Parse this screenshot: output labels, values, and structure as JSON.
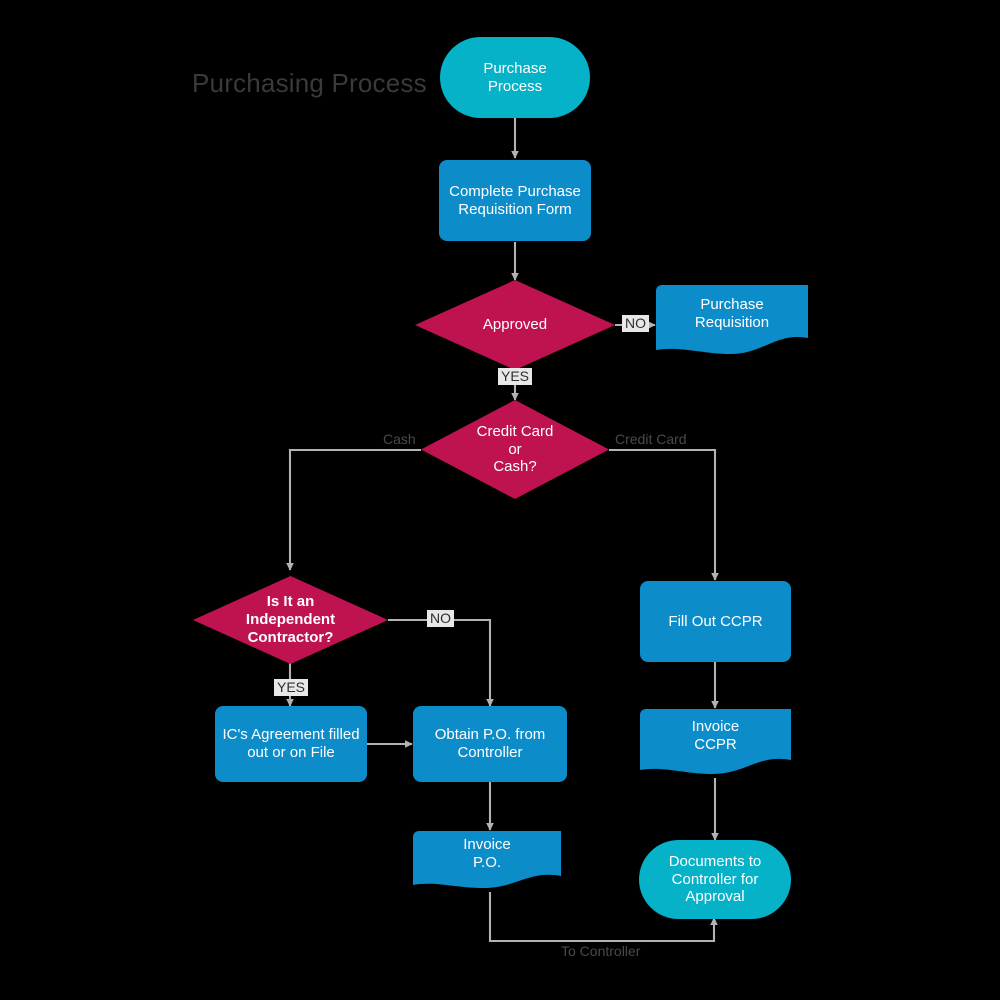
{
  "diagram": {
    "title": "Purchasing Process",
    "background_color": "#000000",
    "title_color": "#3a3a3a",
    "colors": {
      "terminator": "#06b2c8",
      "process": "#0d8cca",
      "decision": "#be1350",
      "document": "#0d8cca",
      "connector": "#b3b3b3",
      "label_text": "#2f2f2f",
      "label_background": "#e8e8e8",
      "node_text": "#ffffff"
    },
    "nodes": [
      {
        "id": "start",
        "type": "terminator",
        "label": "Purchase\nProcess"
      },
      {
        "id": "complete_pr",
        "type": "process",
        "label": "Complete Purchase\nRequisition Form"
      },
      {
        "id": "approved",
        "type": "decision",
        "label": "Approved"
      },
      {
        "id": "pr_doc",
        "type": "document",
        "label": "Purchase\nRequisition"
      },
      {
        "id": "cc_or_cash",
        "type": "decision",
        "label": "Credit Card\nor\nCash?"
      },
      {
        "id": "is_ic",
        "type": "decision",
        "label": "Is It an\nIndependent\nContractor?"
      },
      {
        "id": "fill_ccpr",
        "type": "process",
        "label": "Fill Out CCPR"
      },
      {
        "id": "ic_agreement",
        "type": "process",
        "label": "IC's Agreement filled\nout or on File"
      },
      {
        "id": "obtain_po",
        "type": "process",
        "label": "Obtain P.O. from\nController"
      },
      {
        "id": "invoice_ccpr",
        "type": "document",
        "label": "Invoice\nCCPR"
      },
      {
        "id": "invoice_po",
        "type": "document",
        "label": "Invoice\nP.O."
      },
      {
        "id": "docs_to_ctrl",
        "type": "terminator",
        "label": "Documents to\nController for\nApproval"
      }
    ],
    "edge_labels": [
      {
        "id": "no_approved",
        "text": "NO",
        "style": "boxed"
      },
      {
        "id": "yes_approved",
        "text": "YES",
        "style": "boxed"
      },
      {
        "id": "cash",
        "text": "Cash",
        "style": "plain"
      },
      {
        "id": "credit_card",
        "text": "Credit Card",
        "style": "plain"
      },
      {
        "id": "no_ic",
        "text": "NO",
        "style": "boxed"
      },
      {
        "id": "yes_ic",
        "text": "YES",
        "style": "boxed"
      },
      {
        "id": "to_controller",
        "text": "To Controller",
        "style": "plain"
      }
    ]
  }
}
